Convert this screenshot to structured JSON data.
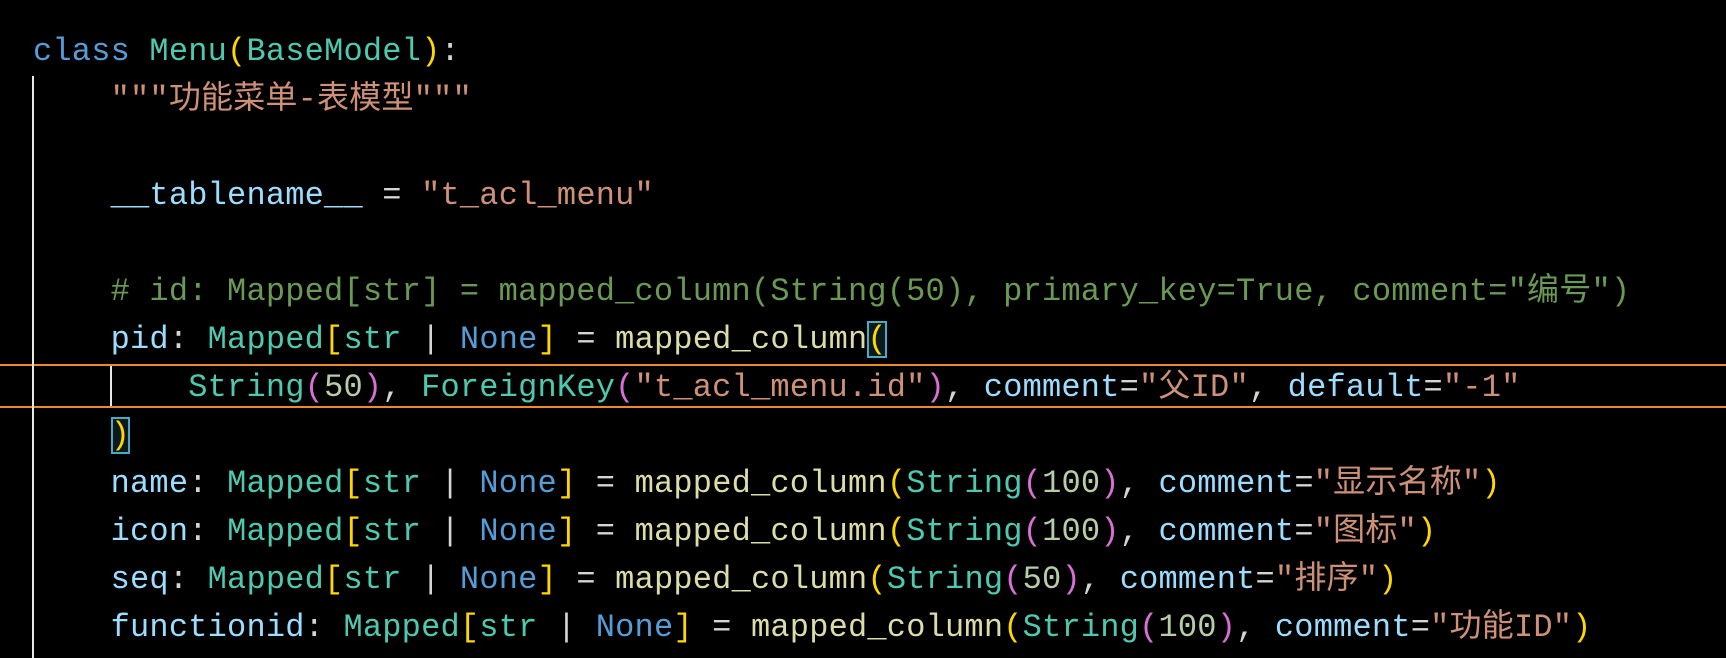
{
  "editor": {
    "colors": {
      "keyword": "#569cd6",
      "class": "#4ec9b0",
      "string": "#ce9178",
      "variable": "#9cdcfe",
      "function": "#dcdcaa",
      "comment": "#6a9955",
      "number": "#b5cea8",
      "current_line_border": "#f08a24"
    },
    "lines": [
      [
        [
          "class ",
          "kw"
        ],
        [
          "Menu",
          "cls"
        ],
        [
          "(",
          "b1"
        ],
        [
          "BaseModel",
          "cls"
        ],
        [
          ")",
          "b1"
        ],
        [
          ":",
          "pl"
        ]
      ],
      [
        [
          "    ",
          "pl"
        ],
        [
          "\"\"\"功能菜单-表模型\"\"\"",
          "str"
        ]
      ],
      [],
      [
        [
          "    ",
          "pl"
        ],
        [
          "__tablename__",
          "var"
        ],
        [
          " = ",
          "pl"
        ],
        [
          "\"t_acl_menu\"",
          "str"
        ]
      ],
      [],
      [
        [
          "    ",
          "pl"
        ],
        [
          "# id: Mapped[str] = mapped_column(String(50), primary_key=True, comment=\"编号\")",
          "cm"
        ]
      ],
      [
        [
          "    ",
          "pl"
        ],
        [
          "pid",
          "var"
        ],
        [
          ": ",
          "pl"
        ],
        [
          "Mapped",
          "cls"
        ],
        [
          "[",
          "b1"
        ],
        [
          "str",
          "cls"
        ],
        [
          " | ",
          "pl"
        ],
        [
          "None",
          "nn"
        ],
        [
          "]",
          "b1"
        ],
        [
          " = ",
          "pl"
        ],
        [
          "mapped_column",
          "fn"
        ],
        [
          "(",
          "b1 match"
        ]
      ],
      [
        [
          "        ",
          "pl"
        ],
        [
          "String",
          "cls"
        ],
        [
          "(",
          "b2"
        ],
        [
          "50",
          "num"
        ],
        [
          ")",
          "b2"
        ],
        [
          ", ",
          "pl"
        ],
        [
          "ForeignKey",
          "cls"
        ],
        [
          "(",
          "b2"
        ],
        [
          "\"t_acl_menu.id\"",
          "str"
        ],
        [
          ")",
          "b2"
        ],
        [
          ", ",
          "pl"
        ],
        [
          "comment",
          "var"
        ],
        [
          "=",
          "pl"
        ],
        [
          "\"父ID\"",
          "str"
        ],
        [
          ", ",
          "pl"
        ],
        [
          "default",
          "var"
        ],
        [
          "=",
          "pl"
        ],
        [
          "\"-1\"",
          "str"
        ]
      ],
      [
        [
          "    ",
          "pl"
        ],
        [
          ")",
          "b1 match"
        ]
      ],
      [
        [
          "    ",
          "pl"
        ],
        [
          "name",
          "var"
        ],
        [
          ": ",
          "pl"
        ],
        [
          "Mapped",
          "cls"
        ],
        [
          "[",
          "b1"
        ],
        [
          "str",
          "cls"
        ],
        [
          " | ",
          "pl"
        ],
        [
          "None",
          "nn"
        ],
        [
          "]",
          "b1"
        ],
        [
          " = ",
          "pl"
        ],
        [
          "mapped_column",
          "fn"
        ],
        [
          "(",
          "b1"
        ],
        [
          "String",
          "cls"
        ],
        [
          "(",
          "b2"
        ],
        [
          "100",
          "num"
        ],
        [
          ")",
          "b2"
        ],
        [
          ", ",
          "pl"
        ],
        [
          "comment",
          "var"
        ],
        [
          "=",
          "pl"
        ],
        [
          "\"显示名称\"",
          "str"
        ],
        [
          ")",
          "b1"
        ]
      ],
      [
        [
          "    ",
          "pl"
        ],
        [
          "icon",
          "var"
        ],
        [
          ": ",
          "pl"
        ],
        [
          "Mapped",
          "cls"
        ],
        [
          "[",
          "b1"
        ],
        [
          "str",
          "cls"
        ],
        [
          " | ",
          "pl"
        ],
        [
          "None",
          "nn"
        ],
        [
          "]",
          "b1"
        ],
        [
          " = ",
          "pl"
        ],
        [
          "mapped_column",
          "fn"
        ],
        [
          "(",
          "b1"
        ],
        [
          "String",
          "cls"
        ],
        [
          "(",
          "b2"
        ],
        [
          "100",
          "num"
        ],
        [
          ")",
          "b2"
        ],
        [
          ", ",
          "pl"
        ],
        [
          "comment",
          "var"
        ],
        [
          "=",
          "pl"
        ],
        [
          "\"图标\"",
          "str"
        ],
        [
          ")",
          "b1"
        ]
      ],
      [
        [
          "    ",
          "pl"
        ],
        [
          "seq",
          "var"
        ],
        [
          ": ",
          "pl"
        ],
        [
          "Mapped",
          "cls"
        ],
        [
          "[",
          "b1"
        ],
        [
          "str",
          "cls"
        ],
        [
          " | ",
          "pl"
        ],
        [
          "None",
          "nn"
        ],
        [
          "]",
          "b1"
        ],
        [
          " = ",
          "pl"
        ],
        [
          "mapped_column",
          "fn"
        ],
        [
          "(",
          "b1"
        ],
        [
          "String",
          "cls"
        ],
        [
          "(",
          "b2"
        ],
        [
          "50",
          "num"
        ],
        [
          ")",
          "b2"
        ],
        [
          ", ",
          "pl"
        ],
        [
          "comment",
          "var"
        ],
        [
          "=",
          "pl"
        ],
        [
          "\"排序\"",
          "str"
        ],
        [
          ")",
          "b1"
        ]
      ],
      [
        [
          "    ",
          "pl"
        ],
        [
          "functionid",
          "var"
        ],
        [
          ": ",
          "pl"
        ],
        [
          "Mapped",
          "cls"
        ],
        [
          "[",
          "b1"
        ],
        [
          "str",
          "cls"
        ],
        [
          " | ",
          "pl"
        ],
        [
          "None",
          "nn"
        ],
        [
          "]",
          "b1"
        ],
        [
          " = ",
          "pl"
        ],
        [
          "mapped_column",
          "fn"
        ],
        [
          "(",
          "b1"
        ],
        [
          "String",
          "cls"
        ],
        [
          "(",
          "b2"
        ],
        [
          "100",
          "num"
        ],
        [
          ")",
          "b2"
        ],
        [
          ", ",
          "pl"
        ],
        [
          "comment",
          "var"
        ],
        [
          "=",
          "pl"
        ],
        [
          "\"功能ID\"",
          "str"
        ],
        [
          ")",
          "b1"
        ]
      ]
    ]
  }
}
